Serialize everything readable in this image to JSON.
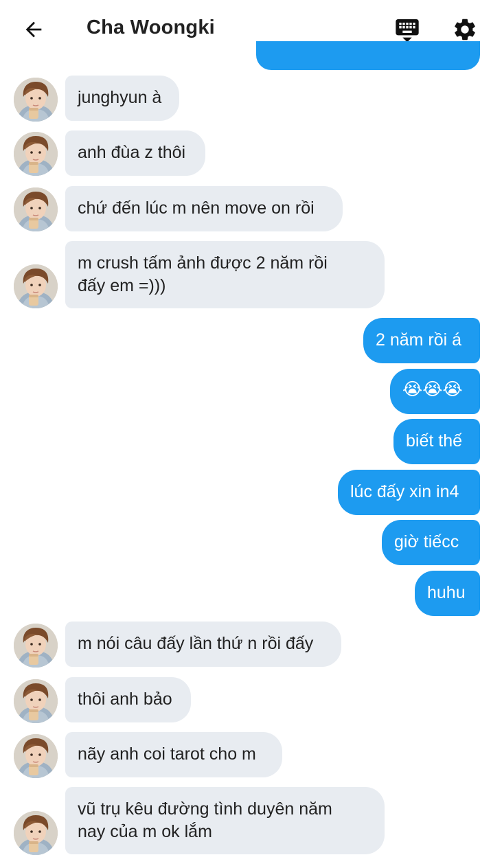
{
  "header": {
    "title": "Cha Woongki",
    "back_icon": "arrow-left-icon",
    "keyboard_icon": "keyboard-icon",
    "settings_icon": "gear-icon"
  },
  "colors": {
    "sent_bubble": "#1d9bf0",
    "received_bubble": "#e8ecf1"
  },
  "messages": {
    "m1": "junghyun à",
    "m2": "anh đùa z thôi",
    "m3": "chứ đến lúc m nên move on rồi",
    "m4a": "m crush tấm ảnh được 2 năm rồi",
    "m4b": "đấy em =)))",
    "m5": "2 năm rồi á",
    "m6": "😭😭😭",
    "m7": "biết thế",
    "m8": "lúc đấy xin in4",
    "m9": "giờ tiếcc",
    "m10": "huhu",
    "m11": "m nói câu đấy lần thứ n rồi đấy",
    "m12": "thôi anh bảo",
    "m13": "nãy anh coi tarot cho m",
    "m14a": "vũ trụ kêu đường tình duyên năm",
    "m14b": "nay của m ok lắm"
  }
}
